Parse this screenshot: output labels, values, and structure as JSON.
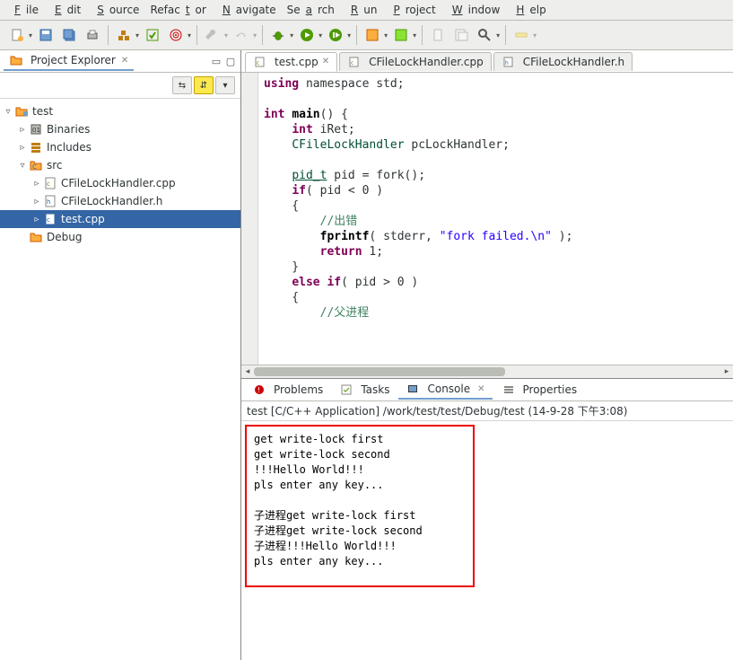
{
  "menu": {
    "file": "File",
    "edit": "Edit",
    "source": "Source",
    "refactor": "Refactor",
    "navigate": "Navigate",
    "search": "Search",
    "run": "Run",
    "project": "Project",
    "window": "Window",
    "help": "Help"
  },
  "project_explorer": {
    "title": "Project Explorer",
    "nodes": {
      "test": "test",
      "binaries": "Binaries",
      "includes": "Includes",
      "src": "src",
      "cfile_cpp": "CFileLockHandler.cpp",
      "cfile_h": "CFileLockHandler.h",
      "test_cpp": "test.cpp",
      "debug": "Debug"
    }
  },
  "editor_tabs": {
    "test_cpp": "test.cpp",
    "cfile_cpp": "CFileLockHandler.cpp",
    "cfile_h": "CFileLockHandler.h"
  },
  "code": {
    "l1_a": "using",
    "l1_b": " namespace std;",
    "l2": "",
    "l3_a": "int",
    "l3_b": " ",
    "l3_c": "main",
    "l3_d": "() {",
    "l4_a": "    ",
    "l4_b": "int",
    "l4_c": " iRet;",
    "l5_a": "    ",
    "l5_b": "CFileLockHandler",
    "l5_c": " pcLockHandler;",
    "l6": "",
    "l7_a": "    ",
    "l7_b": "pid_t",
    "l7_c": " pid = fork();",
    "l8_a": "    ",
    "l8_b": "if",
    "l8_c": "( pid < 0 )",
    "l9": "    {",
    "l10_a": "        ",
    "l10_b": "//出错",
    "l11_a": "        ",
    "l11_b": "fprintf",
    "l11_c": "( stderr, ",
    "l11_d": "\"fork failed.\\n\"",
    "l11_e": " );",
    "l12_a": "        ",
    "l12_b": "return",
    "l12_c": " 1;",
    "l13": "    }",
    "l14_a": "    ",
    "l14_b": "else",
    "l14_c": " ",
    "l14_d": "if",
    "l14_e": "( pid > 0 )",
    "l15": "    {",
    "l16_a": "        ",
    "l16_b": "//父进程"
  },
  "bottom_tabs": {
    "problems": "Problems",
    "tasks": "Tasks",
    "console": "Console",
    "properties": "Properties"
  },
  "console_info": "test [C/C++ Application] /work/test/test/Debug/test (14-9-28 下午3:08)",
  "console_lines": {
    "l1": "get write-lock first",
    "l2": "get write-lock second",
    "l3": "!!!Hello World!!!",
    "l4": "pls enter any key...",
    "l5": "",
    "l6": "子进程get write-lock first",
    "l7": "子进程get write-lock second",
    "l8": "子进程!!!Hello World!!!",
    "l9": "pls enter any key...",
    "l10": ""
  }
}
